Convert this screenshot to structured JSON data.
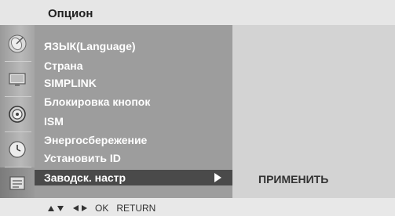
{
  "header": {
    "title": "Опцион"
  },
  "menu": {
    "items": [
      {
        "label": "ЯЗЫК(Language)"
      },
      {
        "label": "Страна"
      },
      {
        "label": "SIMPLINK"
      },
      {
        "label": "Блокировка кнопок"
      },
      {
        "label": "ISM"
      },
      {
        "label": "Энергосбережение"
      },
      {
        "label": "Установить ID"
      },
      {
        "label": "Заводск. настр"
      }
    ],
    "selected_index": 7
  },
  "submenu": {
    "value": "ПРИМЕНИТЬ"
  },
  "footer": {
    "ok_label": "OK",
    "return_label": "RETURN"
  },
  "tabs": [
    {
      "icon": "satellite-dish-icon"
    },
    {
      "icon": "tv-screen-icon"
    },
    {
      "icon": "speaker-icon"
    },
    {
      "icon": "clock-icon"
    },
    {
      "icon": "option-box-icon"
    }
  ],
  "colors": {
    "menu_bg": "#9d9d9d",
    "selected_bg": "#4a4a4a",
    "right_bg": "#d3d3d3"
  }
}
